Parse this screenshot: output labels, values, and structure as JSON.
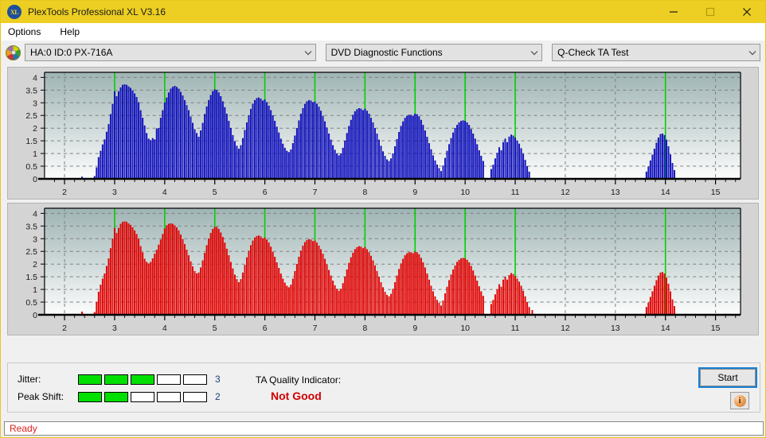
{
  "window": {
    "title": "PlexTools Professional XL V3.16",
    "app_icon": "xl-logo-icon",
    "controls": {
      "minimize": "minimize-icon",
      "maximize": "maximize-icon",
      "close": "close-icon"
    },
    "accent_color": "#edce22",
    "status_bar_text": "Ready",
    "status_bar_color": "#e02020"
  },
  "menu": {
    "items": [
      {
        "label": "Options"
      },
      {
        "label": "Help"
      }
    ]
  },
  "toolbar": {
    "drive_icon": "optical-disc-icon",
    "drive_select": {
      "value": "HA:0 ID:0  PX-716A",
      "chevron": "chevron-down-icon"
    },
    "function_select": {
      "value": "DVD Diagnostic Functions",
      "chevron": "chevron-down-icon"
    },
    "test_select": {
      "value": "Q-Check TA Test",
      "chevron": "chevron-down-icon"
    }
  },
  "indicators": {
    "jitter": {
      "label": "Jitter:",
      "value": 3,
      "segments_total": 5,
      "segments_on": 3,
      "on_color": "#00e000"
    },
    "peak_shift": {
      "label": "Peak Shift:",
      "value": 2,
      "segments_total": 5,
      "segments_on": 2,
      "on_color": "#00e000"
    },
    "ta_quality": {
      "label": "TA Quality Indicator:",
      "value": "Not Good",
      "color": "#d00000"
    },
    "start_button": "Start",
    "info_button": "info-icon"
  },
  "chart_data": [
    {
      "id": "ta-test-upper",
      "type": "bar",
      "title": "",
      "xlabel": "",
      "ylabel": "",
      "series_color": "#1414dc",
      "bar_outline_color": "#000080",
      "marker_color": "#00d000",
      "background_gradient": [
        "#9fb4b4",
        "#fcfcfc"
      ],
      "grid": true,
      "grid_color": "#808080",
      "xlim": [
        1.6,
        15.5
      ],
      "ylim": [
        0,
        4.2
      ],
      "yticks": [
        0,
        0.5,
        1,
        1.5,
        2,
        2.5,
        3,
        3.5,
        4
      ],
      "ytick_labels": [
        "0",
        "0.5",
        "1",
        "1.5",
        "2",
        "2.5",
        "3",
        "3.5",
        "4"
      ],
      "xticks": [
        2,
        3,
        4,
        5,
        6,
        7,
        8,
        9,
        10,
        11,
        12,
        13,
        14,
        15
      ],
      "xtick_labels": [
        "2",
        "3",
        "4",
        "5",
        "6",
        "7",
        "8",
        "9",
        "10",
        "11",
        "12",
        "13",
        "14",
        "15"
      ],
      "marker_lines_x": [
        3,
        4,
        5,
        6,
        7,
        8,
        9,
        10,
        11,
        14
      ],
      "x": [
        2.35,
        2.6,
        2.64,
        2.68,
        2.72,
        2.76,
        2.8,
        2.84,
        2.88,
        2.92,
        2.96,
        3.0,
        3.04,
        3.08,
        3.12,
        3.16,
        3.2,
        3.24,
        3.28,
        3.32,
        3.36,
        3.4,
        3.44,
        3.48,
        3.52,
        3.56,
        3.6,
        3.64,
        3.68,
        3.72,
        3.76,
        3.8,
        3.84,
        3.88,
        3.92,
        3.96,
        4.0,
        4.04,
        4.08,
        4.12,
        4.16,
        4.2,
        4.24,
        4.28,
        4.32,
        4.36,
        4.4,
        4.44,
        4.48,
        4.52,
        4.56,
        4.6,
        4.64,
        4.68,
        4.72,
        4.76,
        4.8,
        4.84,
        4.88,
        4.92,
        4.96,
        5.0,
        5.04,
        5.08,
        5.12,
        5.16,
        5.2,
        5.24,
        5.28,
        5.32,
        5.36,
        5.4,
        5.44,
        5.48,
        5.52,
        5.56,
        5.6,
        5.64,
        5.68,
        5.72,
        5.76,
        5.8,
        5.84,
        5.88,
        5.92,
        5.96,
        6.0,
        6.04,
        6.08,
        6.12,
        6.16,
        6.2,
        6.24,
        6.28,
        6.32,
        6.36,
        6.4,
        6.44,
        6.48,
        6.52,
        6.56,
        6.6,
        6.64,
        6.68,
        6.72,
        6.76,
        6.8,
        6.84,
        6.88,
        6.92,
        6.96,
        7.0,
        7.04,
        7.08,
        7.12,
        7.16,
        7.2,
        7.24,
        7.28,
        7.32,
        7.36,
        7.4,
        7.44,
        7.48,
        7.52,
        7.56,
        7.6,
        7.64,
        7.68,
        7.72,
        7.76,
        7.8,
        7.84,
        7.88,
        7.92,
        7.96,
        8.0,
        8.04,
        8.08,
        8.12,
        8.16,
        8.2,
        8.24,
        8.28,
        8.32,
        8.36,
        8.4,
        8.44,
        8.48,
        8.52,
        8.56,
        8.6,
        8.64,
        8.68,
        8.72,
        8.76,
        8.8,
        8.84,
        8.88,
        8.92,
        8.96,
        9.0,
        9.04,
        9.08,
        9.12,
        9.16,
        9.2,
        9.24,
        9.28,
        9.32,
        9.36,
        9.4,
        9.44,
        9.48,
        9.52,
        9.56,
        9.6,
        9.64,
        9.68,
        9.72,
        9.76,
        9.8,
        9.84,
        9.88,
        9.92,
        9.96,
        10.0,
        10.04,
        10.08,
        10.12,
        10.16,
        10.2,
        10.24,
        10.28,
        10.32,
        10.36,
        10.52,
        10.56,
        10.6,
        10.64,
        10.68,
        10.72,
        10.76,
        10.8,
        10.84,
        10.88,
        10.92,
        10.96,
        11.0,
        11.04,
        11.08,
        11.12,
        11.16,
        11.2,
        11.24,
        11.28,
        13.62,
        13.66,
        13.7,
        13.74,
        13.78,
        13.82,
        13.86,
        13.9,
        13.94,
        13.98,
        14.02,
        14.06,
        14.1,
        14.14,
        14.18
      ],
      "values": [
        0.08,
        0.1,
        0.45,
        0.85,
        1.1,
        1.35,
        1.55,
        1.85,
        2.15,
        2.55,
        2.95,
        3.45,
        3.25,
        3.45,
        3.6,
        3.7,
        3.72,
        3.7,
        3.64,
        3.58,
        3.48,
        3.36,
        3.22,
        3.02,
        2.7,
        2.4,
        2.1,
        1.8,
        1.58,
        1.52,
        1.6,
        1.55,
        1.98,
        2.0,
        2.4,
        2.7,
        3.0,
        3.2,
        3.4,
        3.55,
        3.62,
        3.66,
        3.62,
        3.55,
        3.42,
        3.28,
        3.1,
        2.9,
        2.7,
        2.45,
        2.2,
        1.95,
        1.8,
        1.65,
        1.9,
        2.2,
        2.55,
        2.85,
        3.1,
        3.3,
        3.45,
        3.52,
        3.5,
        3.4,
        3.25,
        3.05,
        2.82,
        2.56,
        2.28,
        2.0,
        1.72,
        1.48,
        1.3,
        1.18,
        1.32,
        1.6,
        1.92,
        2.22,
        2.5,
        2.75,
        2.96,
        3.1,
        3.18,
        3.2,
        3.16,
        3.08,
        3.12,
        3.02,
        2.88,
        2.7,
        2.5,
        2.28,
        2.05,
        1.82,
        1.58,
        1.38,
        1.22,
        1.1,
        1.05,
        1.15,
        1.4,
        1.7,
        2.0,
        2.3,
        2.56,
        2.78,
        2.95,
        3.05,
        3.1,
        3.08,
        3.02,
        3.04,
        2.96,
        2.84,
        2.68,
        2.48,
        2.26,
        2.02,
        1.78,
        1.54,
        1.32,
        1.14,
        1.0,
        0.92,
        1.0,
        1.22,
        1.5,
        1.8,
        2.08,
        2.32,
        2.52,
        2.66,
        2.74,
        2.78,
        2.76,
        2.7,
        2.76,
        2.68,
        2.56,
        2.4,
        2.22,
        2.0,
        1.78,
        1.54,
        1.3,
        1.08,
        0.9,
        0.76,
        0.7,
        0.8,
        1.0,
        1.28,
        1.56,
        1.84,
        2.08,
        2.26,
        2.4,
        2.48,
        2.52,
        2.52,
        2.48,
        2.56,
        2.54,
        2.46,
        2.32,
        2.12,
        1.9,
        1.65,
        1.4,
        1.16,
        0.92,
        0.72,
        0.56,
        0.42,
        0.3,
        0.52,
        0.82,
        1.1,
        1.36,
        1.6,
        1.82,
        2.0,
        2.12,
        2.22,
        2.28,
        2.3,
        2.28,
        2.22,
        2.12,
        1.96,
        1.78,
        1.58,
        1.36,
        1.12,
        0.9,
        0.7,
        0.38,
        0.55,
        0.8,
        1.02,
        1.24,
        1.12,
        1.44,
        1.58,
        1.44,
        1.66,
        1.74,
        1.7,
        1.62,
        1.5,
        1.38,
        1.2,
        0.98,
        0.74,
        0.5,
        0.28,
        0.28,
        0.48,
        0.72,
        0.95,
        1.18,
        1.42,
        1.62,
        1.76,
        1.78,
        1.72,
        1.54,
        1.28,
        0.96,
        0.62,
        0.34
      ]
    },
    {
      "id": "ta-test-lower",
      "type": "bar",
      "title": "",
      "xlabel": "",
      "ylabel": "",
      "series_color": "#f40000",
      "bar_outline_color": "#c00000",
      "marker_color": "#00d000",
      "background_gradient": [
        "#9fb4b4",
        "#fcfcfc"
      ],
      "grid": true,
      "grid_color": "#808080",
      "xlim": [
        1.6,
        15.5
      ],
      "ylim": [
        0,
        4.2
      ],
      "yticks": [
        0,
        0.5,
        1,
        1.5,
        2,
        2.5,
        3,
        3.5,
        4
      ],
      "ytick_labels": [
        "0",
        "0.5",
        "1",
        "1.5",
        "2",
        "2.5",
        "3",
        "3.5",
        "4"
      ],
      "xticks": [
        2,
        3,
        4,
        5,
        6,
        7,
        8,
        9,
        10,
        11,
        12,
        13,
        14,
        15
      ],
      "xtick_labels": [
        "2",
        "3",
        "4",
        "5",
        "6",
        "7",
        "8",
        "9",
        "10",
        "11",
        "12",
        "13",
        "14",
        "15"
      ],
      "marker_lines_x": [
        3,
        4,
        5,
        6,
        7,
        8,
        9,
        10,
        11,
        14
      ],
      "x": [
        2.35,
        2.6,
        2.64,
        2.68,
        2.72,
        2.76,
        2.8,
        2.84,
        2.88,
        2.92,
        2.96,
        3.0,
        3.04,
        3.08,
        3.12,
        3.16,
        3.2,
        3.24,
        3.28,
        3.32,
        3.36,
        3.4,
        3.44,
        3.48,
        3.52,
        3.56,
        3.6,
        3.64,
        3.68,
        3.72,
        3.76,
        3.8,
        3.84,
        3.88,
        3.92,
        3.96,
        4.0,
        4.04,
        4.08,
        4.12,
        4.16,
        4.2,
        4.24,
        4.28,
        4.32,
        4.36,
        4.4,
        4.44,
        4.48,
        4.52,
        4.56,
        4.6,
        4.64,
        4.68,
        4.72,
        4.76,
        4.8,
        4.84,
        4.88,
        4.92,
        4.96,
        5.0,
        5.04,
        5.08,
        5.12,
        5.16,
        5.2,
        5.24,
        5.28,
        5.32,
        5.36,
        5.4,
        5.44,
        5.48,
        5.52,
        5.56,
        5.6,
        5.64,
        5.68,
        5.72,
        5.76,
        5.8,
        5.84,
        5.88,
        5.92,
        5.96,
        6.0,
        6.04,
        6.08,
        6.12,
        6.16,
        6.2,
        6.24,
        6.28,
        6.32,
        6.36,
        6.4,
        6.44,
        6.48,
        6.52,
        6.56,
        6.6,
        6.64,
        6.68,
        6.72,
        6.76,
        6.8,
        6.84,
        6.88,
        6.92,
        6.96,
        7.0,
        7.04,
        7.08,
        7.12,
        7.16,
        7.2,
        7.24,
        7.28,
        7.32,
        7.36,
        7.4,
        7.44,
        7.48,
        7.52,
        7.56,
        7.6,
        7.64,
        7.68,
        7.72,
        7.76,
        7.8,
        7.84,
        7.88,
        7.92,
        7.96,
        8.0,
        8.04,
        8.08,
        8.12,
        8.16,
        8.2,
        8.24,
        8.28,
        8.32,
        8.36,
        8.4,
        8.44,
        8.48,
        8.52,
        8.56,
        8.6,
        8.64,
        8.68,
        8.72,
        8.76,
        8.8,
        8.84,
        8.88,
        8.92,
        8.96,
        9.0,
        9.04,
        9.08,
        9.12,
        9.16,
        9.2,
        9.24,
        9.28,
        9.32,
        9.36,
        9.4,
        9.44,
        9.48,
        9.52,
        9.56,
        9.6,
        9.64,
        9.68,
        9.72,
        9.76,
        9.8,
        9.84,
        9.88,
        9.92,
        9.96,
        10.0,
        10.04,
        10.08,
        10.12,
        10.16,
        10.2,
        10.24,
        10.28,
        10.32,
        10.36,
        10.52,
        10.56,
        10.6,
        10.64,
        10.68,
        10.72,
        10.76,
        10.8,
        10.84,
        10.88,
        10.92,
        10.96,
        11.0,
        11.04,
        11.08,
        11.12,
        11.16,
        11.2,
        11.24,
        11.28,
        11.34,
        13.62,
        13.66,
        13.7,
        13.74,
        13.78,
        13.82,
        13.86,
        13.9,
        13.94,
        13.98,
        14.02,
        14.06,
        14.1,
        14.14,
        14.18
      ],
      "values": [
        0.12,
        0.1,
        0.5,
        0.9,
        1.18,
        1.42,
        1.62,
        1.92,
        2.22,
        2.62,
        3.0,
        3.42,
        3.22,
        3.42,
        3.58,
        3.66,
        3.68,
        3.66,
        3.6,
        3.54,
        3.44,
        3.32,
        3.18,
        3.0,
        2.7,
        2.46,
        2.2,
        2.08,
        2.02,
        2.08,
        2.22,
        2.4,
        2.56,
        2.76,
        2.96,
        3.18,
        3.4,
        3.52,
        3.58,
        3.6,
        3.58,
        3.52,
        3.44,
        3.32,
        3.16,
        2.98,
        2.78,
        2.56,
        2.34,
        2.1,
        1.9,
        1.72,
        1.62,
        1.66,
        1.86,
        2.14,
        2.44,
        2.74,
        3.0,
        3.22,
        3.38,
        3.46,
        3.46,
        3.38,
        3.24,
        3.06,
        2.84,
        2.6,
        2.34,
        2.08,
        1.82,
        1.58,
        1.4,
        1.28,
        1.4,
        1.66,
        1.96,
        2.26,
        2.52,
        2.74,
        2.92,
        3.04,
        3.1,
        3.12,
        3.08,
        3.0,
        3.04,
        2.96,
        2.84,
        2.68,
        2.48,
        2.28,
        2.06,
        1.84,
        1.62,
        1.42,
        1.26,
        1.14,
        1.08,
        1.18,
        1.42,
        1.72,
        2.0,
        2.28,
        2.52,
        2.72,
        2.86,
        2.94,
        2.98,
        2.96,
        2.9,
        2.92,
        2.84,
        2.72,
        2.58,
        2.4,
        2.2,
        1.98,
        1.76,
        1.54,
        1.34,
        1.16,
        1.02,
        0.94,
        1.02,
        1.24,
        1.5,
        1.78,
        2.04,
        2.26,
        2.44,
        2.58,
        2.66,
        2.7,
        2.68,
        2.62,
        2.66,
        2.58,
        2.46,
        2.32,
        2.14,
        1.94,
        1.72,
        1.5,
        1.28,
        1.08,
        0.9,
        0.78,
        0.72,
        0.82,
        1.02,
        1.28,
        1.54,
        1.8,
        2.02,
        2.2,
        2.34,
        2.42,
        2.46,
        2.46,
        2.42,
        2.48,
        2.46,
        2.38,
        2.24,
        2.06,
        1.86,
        1.62,
        1.38,
        1.14,
        0.92,
        0.72,
        0.58,
        0.46,
        0.36,
        0.56,
        0.84,
        1.1,
        1.36,
        1.58,
        1.78,
        1.94,
        2.08,
        2.16,
        2.22,
        2.24,
        2.22,
        2.16,
        2.06,
        1.92,
        1.74,
        1.54,
        1.34,
        1.12,
        0.92,
        0.74,
        0.42,
        0.58,
        0.8,
        1.0,
        1.2,
        1.1,
        1.38,
        1.5,
        1.38,
        1.56,
        1.64,
        1.6,
        1.52,
        1.42,
        1.3,
        1.14,
        0.94,
        0.72,
        0.5,
        0.3,
        0.18,
        0.3,
        0.48,
        0.7,
        0.92,
        1.14,
        1.36,
        1.54,
        1.66,
        1.68,
        1.62,
        1.46,
        1.22,
        0.92,
        0.6,
        0.34
      ]
    }
  ]
}
